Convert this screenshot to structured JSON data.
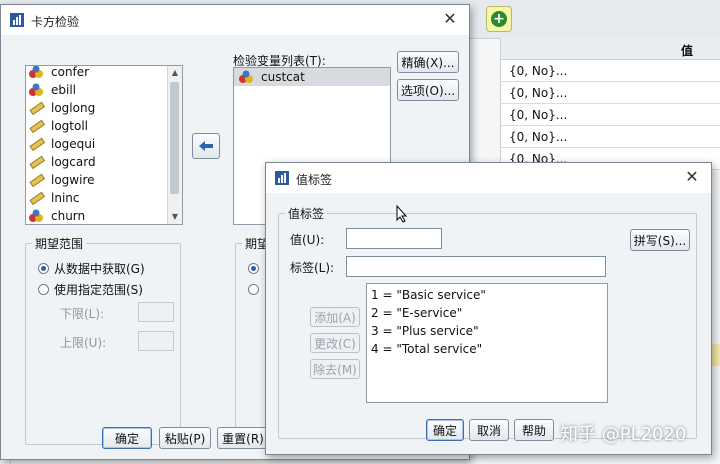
{
  "background": {
    "column_header": "值",
    "rows": [
      "{0, No}...",
      "{0, No}...",
      "{0, No}...",
      "{0, No}...",
      "{0, No}..."
    ]
  },
  "chi_dialog": {
    "title": "卡方检验",
    "source_variables": [
      "confer",
      "ebill",
      "loglong",
      "logtoll",
      "logequi",
      "logcard",
      "logwire",
      "lninc",
      "churn"
    ],
    "test_var_label": "检验变量列表(T):",
    "test_variables": [
      "custcat"
    ],
    "exact_button": "精确(X)...",
    "options_button": "选项(O)...",
    "expected_range": {
      "title": "期望范围",
      "from_data": "从数据中获取(G)",
      "use_range": "使用指定范围(S)",
      "lower_label": "下限(L):",
      "upper_label": "上限(U):"
    },
    "expected_values_title": "期望值",
    "buttons": {
      "ok": "确定",
      "paste": "粘贴(P)",
      "reset": "重置(R)"
    }
  },
  "value_labels_dialog": {
    "title": "值标签",
    "group_title": "值标签",
    "value_label": "值(U):",
    "label_label": "标签(L):",
    "value_input": "",
    "label_input": "",
    "spelling_button": "拼写(S)...",
    "add_button": "添加(A)",
    "change_button": "更改(C)",
    "remove_button": "除去(M)",
    "labels_list": [
      "1 = \"Basic service\"",
      "2 = \"E-service\"",
      "3 = \"Plus service\"",
      "4 = \"Total service\""
    ],
    "buttons": {
      "ok": "确定",
      "cancel": "取消",
      "help": "帮助"
    }
  },
  "watermark": "知乎 @PL2020"
}
